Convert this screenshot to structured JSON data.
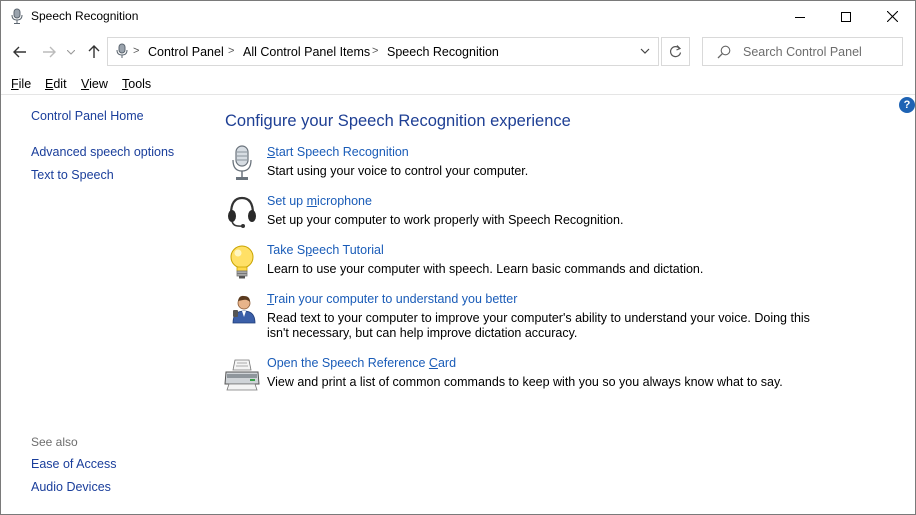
{
  "window": {
    "title": "Speech Recognition",
    "icon": "microphone-icon"
  },
  "navigation": {
    "breadcrumbs": [
      "Control Panel",
      "All Control Panel Items",
      "Speech Recognition"
    ],
    "search_placeholder": "Search Control Panel"
  },
  "menubar": {
    "items": [
      {
        "label": "File",
        "accel": "F"
      },
      {
        "label": "Edit",
        "accel": "E"
      },
      {
        "label": "View",
        "accel": "V"
      },
      {
        "label": "Tools",
        "accel": "T"
      }
    ]
  },
  "left_nav": {
    "home": "Control Panel Home",
    "links": [
      "Advanced speech options",
      "Text to Speech"
    ],
    "see_also_title": "See also",
    "see_also": [
      "Ease of Access",
      "Audio Devices"
    ]
  },
  "main": {
    "title": "Configure your Speech Recognition experience",
    "tasks": [
      {
        "label": "Start Speech Recognition",
        "description": "Start using your voice to control your computer.",
        "icon": "microphone-icon"
      },
      {
        "label": "Set up microphone",
        "description": "Set up your computer to work properly with Speech Recognition.",
        "icon": "headset-icon"
      },
      {
        "label": "Take Speech Tutorial",
        "description": "Learn to use your computer with speech. Learn basic commands and dictation.",
        "icon": "lightbulb-icon"
      },
      {
        "label": "Train your computer to understand you better",
        "description": "Read text to your computer to improve your computer's ability to understand your voice. Doing this isn't necessary, but can help improve dictation accuracy.",
        "icon": "user-icon"
      },
      {
        "label": "Open the Speech Reference Card",
        "description": "View and print a list of common commands to keep with you so you always know what to say.",
        "icon": "printer-icon"
      }
    ]
  },
  "colors": {
    "link": "#1a5cb8",
    "nav_link": "#1a3e9b",
    "heading": "#1e3f94",
    "help": "#1e63b4"
  }
}
